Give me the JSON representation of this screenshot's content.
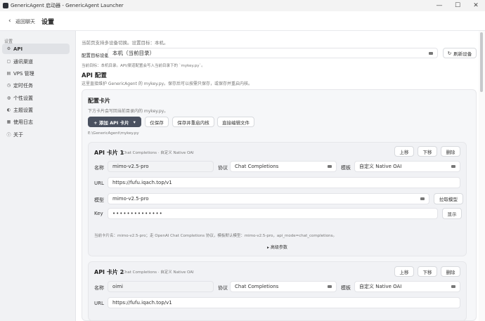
{
  "window": {
    "title": "GenericAgent 启动器 - GenericAgent Launcher",
    "minimize": "—",
    "maximize": "☐",
    "close": "✕"
  },
  "header": {
    "back_icon": "‹",
    "back_label": "返回聊天",
    "page_title": "设置"
  },
  "sidebar": {
    "section": "设置",
    "items": [
      {
        "label": "API",
        "icon": "⚙"
      },
      {
        "label": "通讯渠道",
        "icon": "▢"
      },
      {
        "label": "VPS 管理",
        "icon": "▤"
      },
      {
        "label": "定时任务",
        "icon": "◷"
      },
      {
        "label": "个性设置",
        "icon": "◍"
      },
      {
        "label": "主题设置",
        "icon": "◐"
      },
      {
        "label": "使用日志",
        "icon": "▦"
      },
      {
        "label": "关于",
        "icon": "ⓘ"
      }
    ]
  },
  "device": {
    "hint": "当前页支持多设备切换。设置目标：本机。",
    "label": "配置目标设备",
    "value": "本机（当前目录）",
    "refresh_icon": "↻",
    "refresh_label": "刷新设备",
    "target_hint": "当前目标：本机目录。API/渠道配置会写入当前目录下的 `mykey.py`。"
  },
  "api_section": {
    "title": "API 配置",
    "desc": "这里直接维护 GenericAgent 的 mykey.py。保存后可以按需只保存，或保存并重启内核。"
  },
  "config_card": {
    "title": "配置卡片",
    "desc": "下方卡片会写回当前目录内的 mykey.py。",
    "add_label": "+ 添加 API 卡片",
    "add_caret": "▾",
    "save_label": "仅保存",
    "save_restart_label": "保存并重启内核",
    "edit_file_label": "直接编辑文件",
    "path": "E:\\GenericAgent\\mykey.py"
  },
  "cards": [
    {
      "title": "API 卡片 1",
      "subtitle": "Chat Completions · 自定义 Native OAI",
      "up": "上移",
      "down": "下移",
      "delete": "删除",
      "name_label": "名称",
      "name": "mimo-v2.5-pro",
      "protocol_label": "协议",
      "protocol": "Chat Completions",
      "template_label": "模板",
      "template": "自定义 Native OAI",
      "url_label": "URL",
      "url": "https://fufu.iqach.top/v1",
      "model_label": "模型",
      "model": "mimo-v2.5-pro",
      "fetch_models": "拉取模型",
      "key_label": "Key",
      "key": "••••••••••••••",
      "show_key": "显示",
      "summary": "当前卡片名：mimo-v2.5-pro；走 OpenAI Chat Completions 协议，模板默认模型：mimo-v2.5-pro，api_mode=chat_completions。",
      "advanced": "▸ 高级参数"
    },
    {
      "title": "API 卡片 2",
      "subtitle": "Chat Completions · 自定义 Native OAI",
      "up": "上移",
      "down": "下移",
      "delete": "删除",
      "name_label": "名称",
      "name": "oimi",
      "protocol_label": "协议",
      "protocol": "Chat Completions",
      "template_label": "模板",
      "template": "自定义 Native OAI",
      "url_label": "URL",
      "url": "https://fufu.iqach.top/v1"
    }
  ]
}
